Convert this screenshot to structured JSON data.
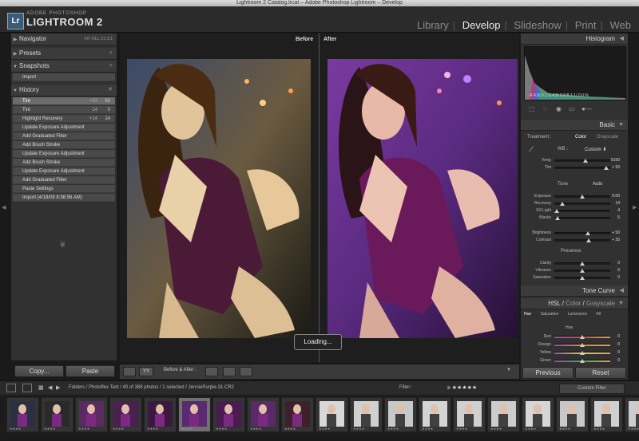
{
  "window": {
    "title": "Lightroom 2 Catalog.lrcat – Adobe Photoshop Lightroom – Develop"
  },
  "brand": {
    "badge": "Lr",
    "line1": "ADOBE PHOTOSHOP",
    "line2": "LIGHTROOM 2"
  },
  "modules": [
    "Library",
    "Develop",
    "Slideshow",
    "Print",
    "Web"
  ],
  "active_module": "Develop",
  "left_panel": {
    "navigator": {
      "label": "Navigator",
      "zoom_options": [
        "FIT",
        "FILL",
        "1:1",
        "3:1"
      ]
    },
    "presets": {
      "label": "Presets"
    },
    "snapshots": {
      "label": "Snapshots",
      "items": [
        "Import"
      ]
    },
    "history": {
      "label": "History",
      "items": [
        {
          "label": "Tint",
          "v1": "+93",
          "v2": "93",
          "selected": true
        },
        {
          "label": "Tint",
          "v1": "14",
          "v2": "0"
        },
        {
          "label": "Highlight Recovery",
          "v1": "+14",
          "v2": "14"
        },
        {
          "label": "Update Exposure Adjustment"
        },
        {
          "label": "Add Graduated Filter"
        },
        {
          "label": "Add Brush Stroke"
        },
        {
          "label": "Update Exposure Adjustment"
        },
        {
          "label": "Add Brush Stroke"
        },
        {
          "label": "Update Exposure Adjustment"
        },
        {
          "label": "Add Graduated Filter"
        },
        {
          "label": "Paste Settings"
        },
        {
          "label": "Import (4/18/09 8:36:56 AM)"
        }
      ]
    },
    "copy_button": "Copy...",
    "paste_button": "Paste"
  },
  "center": {
    "before_label": "Before",
    "after_label": "After",
    "loading_text": "Loading...",
    "view_label": "Before & After :",
    "view_options_icon": "YY"
  },
  "right_panel": {
    "histogram_label": "Histogram",
    "histogram_readout": "R 4.5/ 0.1  G 4.5/ 0.8  B 1.1/ 0.0 %",
    "basic_label": "Basic",
    "treatment_label": "Treatment :",
    "treatment_color": "Color",
    "treatment_grayscale": "Grayscale",
    "wb_label": "WB :",
    "wb_value": "Custom",
    "tone_label": "Tone",
    "tone_auto": "Auto",
    "presence_label": "Presence",
    "sliders": [
      {
        "label": "Temp",
        "value": "5150",
        "pos": 0.55
      },
      {
        "label": "Tint",
        "value": "+ 93",
        "pos": 0.93
      },
      {
        "label": "Exposure",
        "value": "0.00",
        "pos": 0.5
      },
      {
        "label": "Recovery",
        "value": "14",
        "pos": 0.14
      },
      {
        "label": "Fill Light",
        "value": "4",
        "pos": 0.04
      },
      {
        "label": "Blacks",
        "value": "5",
        "pos": 0.05
      },
      {
        "label": "Brightness",
        "value": "+ 50",
        "pos": 0.6
      },
      {
        "label": "Contrast",
        "value": "+ 25",
        "pos": 0.62
      },
      {
        "label": "Clarity",
        "value": "0",
        "pos": 0.5
      },
      {
        "label": "Vibrance",
        "value": "0",
        "pos": 0.5
      },
      {
        "label": "Saturation",
        "value": "0",
        "pos": 0.5
      }
    ],
    "tone_curve_label": "Tone Curve",
    "hsl_label": "HSL",
    "color_label": "Color",
    "grayscale_label": "Grayscale",
    "hsl_tabs": [
      "Hue",
      "Saturation",
      "Luminance",
      "All"
    ],
    "hue_label": "Hue",
    "hue_sliders": [
      {
        "label": "Red",
        "value": "0",
        "color": "#e04040"
      },
      {
        "label": "Orange",
        "value": "0",
        "color": "#e09030"
      },
      {
        "label": "Yellow",
        "value": "0",
        "color": "#d8d040"
      },
      {
        "label": "Green",
        "value": "0",
        "color": "#40b040"
      }
    ],
    "previous_button": "Previous",
    "reset_button": "Reset"
  },
  "filmstrip": {
    "path": "Folders / Photoflex Test / 40 of 388 photos / 1 selected / JenniePurple-31.CR2",
    "filter_label": "Filter :",
    "rating_filter": "≥ ★★★★★",
    "custom_filter": "Custom Filter",
    "thumb_count": 19
  },
  "colors": {
    "panel": "#313131",
    "header": "#3b3b3b",
    "selected_row": "#6b6b6b",
    "active_module": "#eaeaea"
  }
}
